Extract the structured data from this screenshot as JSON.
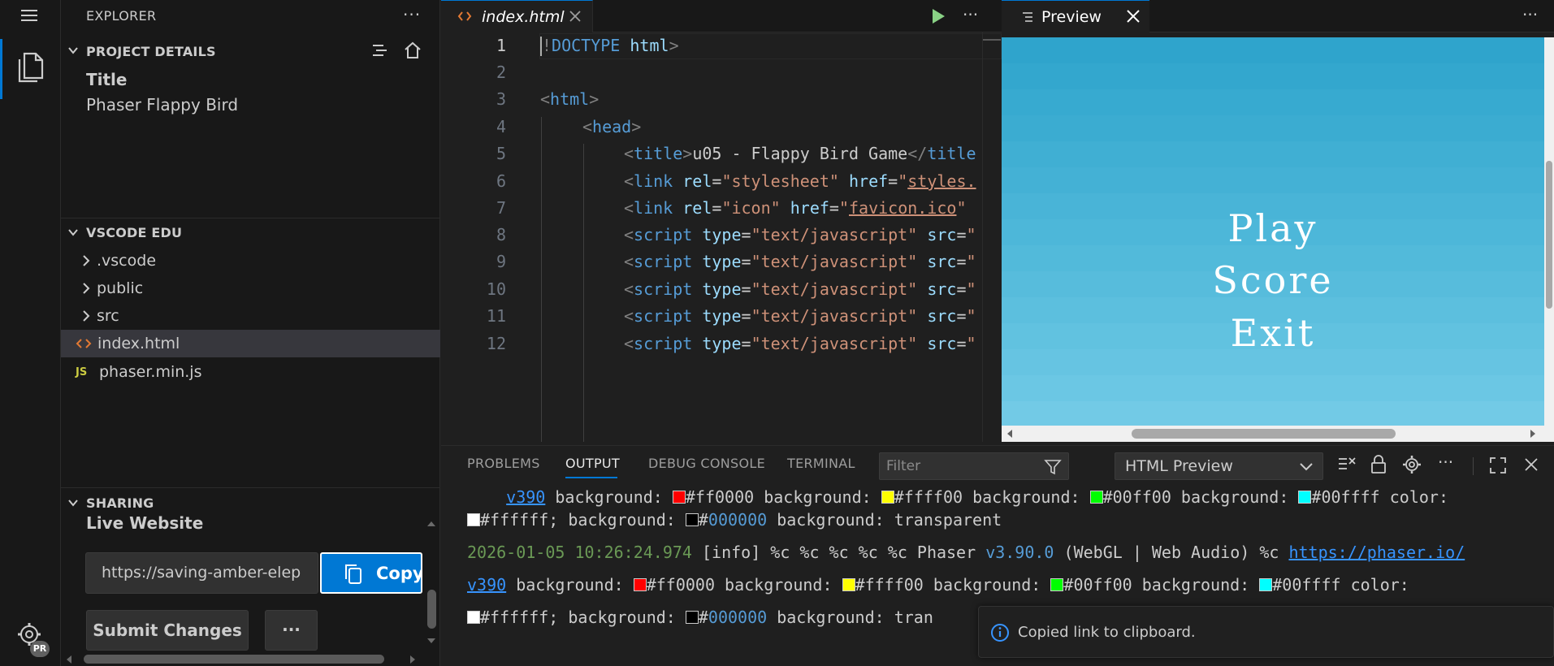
{
  "sidebar": {
    "title": "EXPLORER",
    "project_details": {
      "heading": "PROJECT DETAILS",
      "title_label": "Title",
      "title_value": "Phaser Flappy Bird"
    },
    "vscode_edu": {
      "heading": "VSCODE EDU",
      "items": [
        {
          "label": ".vscode",
          "type": "folder"
        },
        {
          "label": "public",
          "type": "folder"
        },
        {
          "label": "src",
          "type": "folder"
        },
        {
          "label": "index.html",
          "type": "html-file"
        },
        {
          "label": "phaser.min.js",
          "type": "js-file",
          "badge": "JS"
        }
      ]
    },
    "sharing": {
      "heading": "SHARING",
      "live_label": "Live Website",
      "url_value": "https://saving-amber-elep",
      "copy_label": "Copy",
      "submit_label": "Submit Changes",
      "more_label": "···"
    },
    "account_badge": "PR"
  },
  "editor": {
    "tab_label": "index.html",
    "line_numbers": [
      "1",
      "2",
      "3",
      "4",
      "5",
      "6",
      "7",
      "8",
      "9",
      "10",
      "11",
      "12"
    ]
  },
  "preview": {
    "tab_label": "Preview",
    "menu": [
      "Play",
      "Score",
      "Exit"
    ]
  },
  "panel": {
    "tabs": [
      "PROBLEMS",
      "OUTPUT",
      "DEBUG CONSOLE",
      "TERMINAL"
    ],
    "active_tab": "OUTPUT",
    "filter_placeholder": "Filter",
    "channel": "HTML Preview"
  },
  "output": {
    "partial_top": "v390 background:  #ff0000 background:  #ffff00 background:  #00ff00 background:  #00ffff color:",
    "line1_white": "#ffffff; background: ",
    "line1_black": "#",
    "line1_black_num": "000000",
    "line1_rest": " background: transparent",
    "log_timestamp": "2026-01-05 10:26:24.974",
    "log_text_a": " [info] %c %c %c %c %c Phaser ",
    "log_version": "v3.90.0",
    "log_text_b": " (WebGL | Web Audio) %c ",
    "log_link": "https://phaser.io/",
    "log_link2": "v390",
    "bg_label": " background: ",
    "red": "#ff0000",
    "yellow": "#ffff00",
    "green": "#00ff00",
    "cyan": "#00ffff",
    "color_label": " color:",
    "line3_tail": " background: tran"
  },
  "toast": {
    "message": "Copied link to clipboard."
  },
  "colors": {
    "accent": "#0078d4",
    "sky_top": "#2fa4cc",
    "sky_bottom": "#74cae6"
  }
}
